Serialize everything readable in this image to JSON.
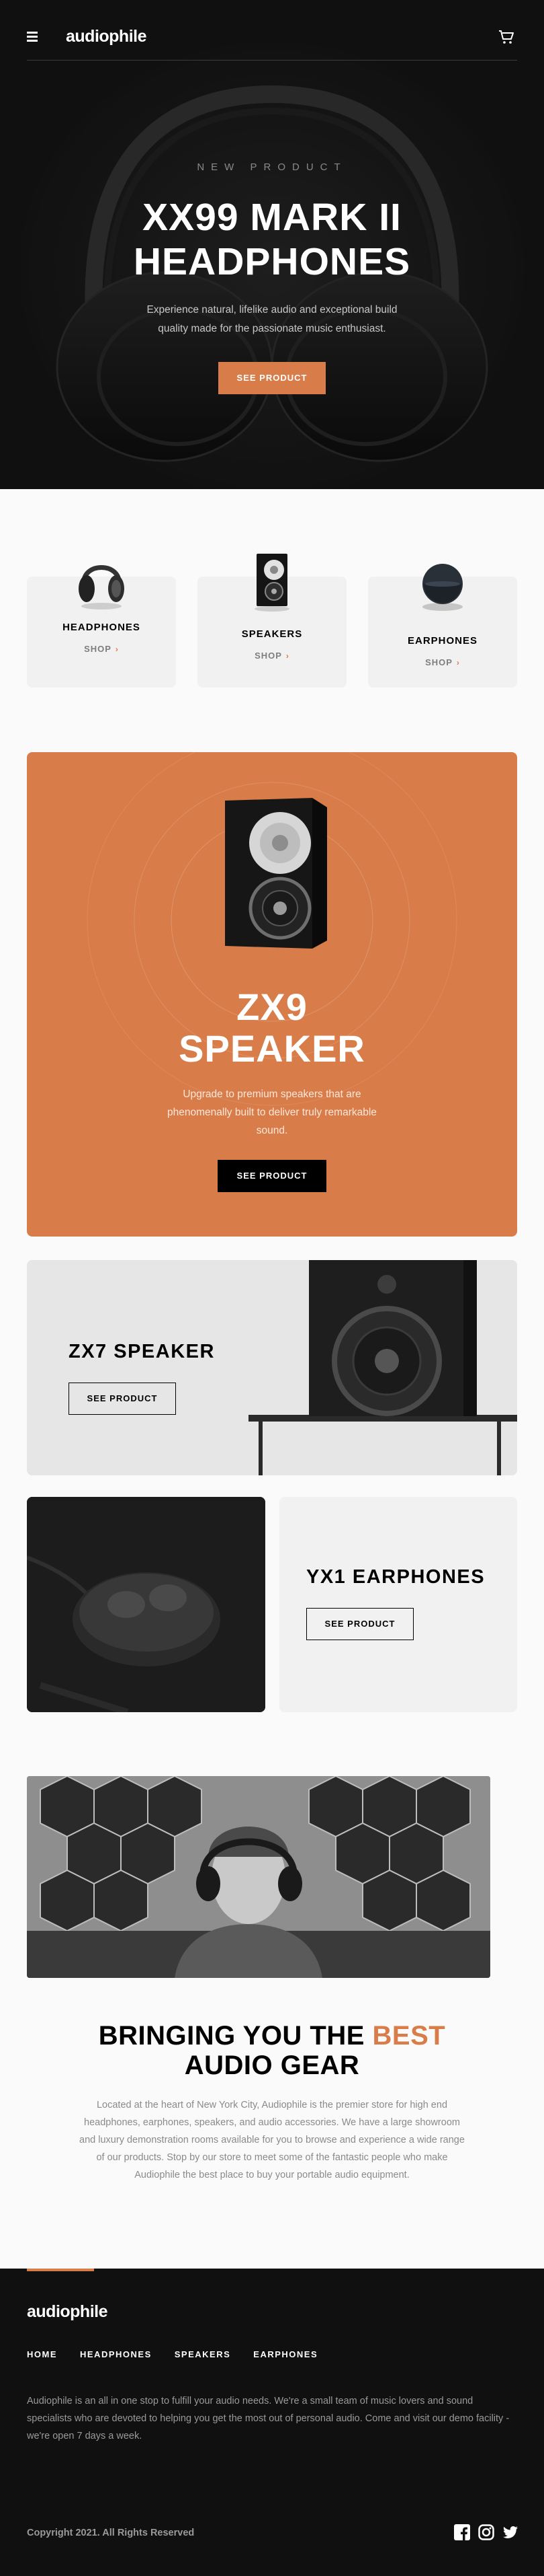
{
  "header": {
    "logo": "audiophile",
    "menu_icon": "hamburger-menu-icon",
    "cart_icon": "cart-icon"
  },
  "hero": {
    "overline": "NEW PRODUCT",
    "title": "XX99 MARK II HEADPHONES",
    "description": "Experience natural, lifelike audio and exceptional build quality made for the passionate music enthusiast.",
    "button": "SEE PRODUCT"
  },
  "categories": [
    {
      "title": "HEADPHONES",
      "link": "SHOP"
    },
    {
      "title": "SPEAKERS",
      "link": "SHOP"
    },
    {
      "title": "EARPHONES",
      "link": "SHOP"
    }
  ],
  "zx9": {
    "title_line1": "ZX9",
    "title_line2": "SPEAKER",
    "description": "Upgrade to premium speakers that are phenomenally built to deliver truly remarkable sound.",
    "button": "SEE PRODUCT"
  },
  "zx7": {
    "title": "ZX7 SPEAKER",
    "button": "SEE PRODUCT"
  },
  "yx1": {
    "title": "YX1 EARPHONES",
    "button": "SEE PRODUCT"
  },
  "about": {
    "title_part1": "BRINGING YOU THE ",
    "title_accent": "BEST",
    "title_part2": "AUDIO GEAR",
    "description": "Located at the heart of New York City, Audiophile is the premier store for high end headphones, earphones, speakers, and audio accessories. We have a large showroom and luxury demonstration rooms available for you to browse and experience a wide range of our products. Stop by our store to meet some of the fantastic people who make Audiophile the best place to buy your portable audio equipment."
  },
  "footer": {
    "logo": "audiophile",
    "nav": [
      "HOME",
      "HEADPHONES",
      "SPEAKERS",
      "EARPHONES"
    ],
    "description": "Audiophile is an all in one stop to fulfill your audio needs. We're a small team of music lovers and sound specialists who are devoted to helping you get the most out of personal audio. Come and visit our demo facility - we're open 7 days a week.",
    "copyright": "Copyright 2021. All Rights Reserved",
    "socials": [
      "facebook-icon",
      "instagram-icon",
      "twitter-icon"
    ]
  },
  "colors": {
    "accent": "#d87d4a",
    "dark": "#101010",
    "light_gray": "#f1f1f1"
  }
}
